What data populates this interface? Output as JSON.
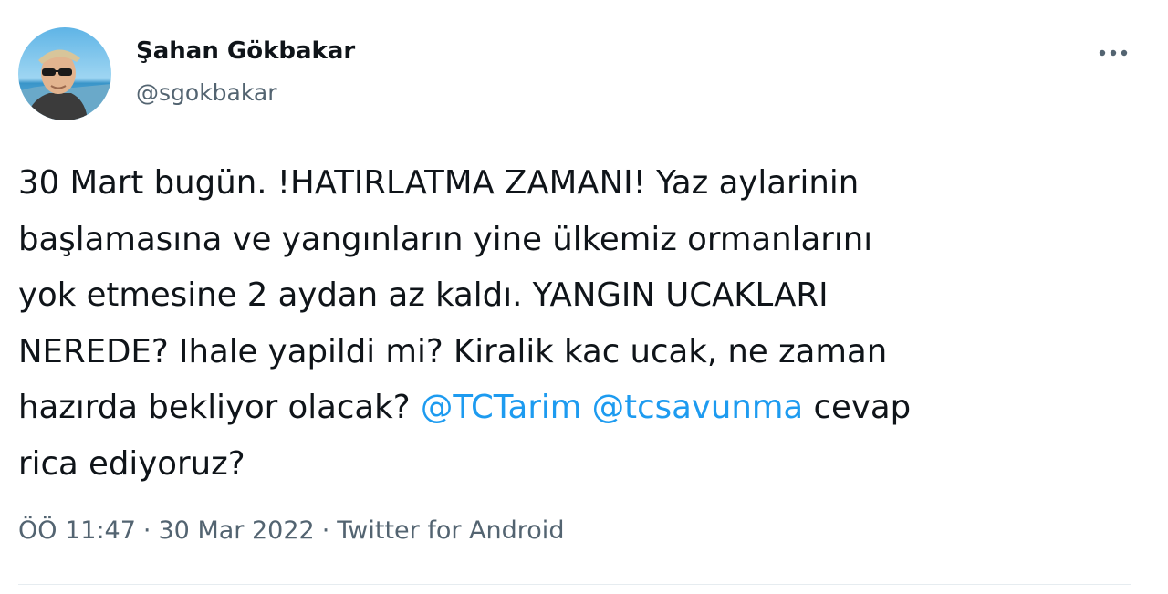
{
  "author": {
    "display_name": "Şahan Gökbakar",
    "handle": "@sgokbakar"
  },
  "more_icon": "more-horizontal-icon",
  "tweet": {
    "lines": [
      [
        "30 Mart bugün. !HATIRLATMA ZAMANI! Yaz aylarinin"
      ],
      [
        "başlamasına ve yangınların yine ülkemiz ormanlarını"
      ],
      [
        "yok etmesine 2 aydan az kaldı. YANGIN UCAKLARI"
      ],
      [
        "NEREDE? Ihale yapildi mi? Kiralik kac ucak, ne zaman"
      ],
      [
        "hazırda bekliyor olacak? ",
        "@TCTarim",
        " ",
        "@tcsavunma",
        " cevap"
      ],
      [
        "rica ediyoruz?"
      ]
    ],
    "mentions": [
      "@TCTarim",
      "@tcsavunma"
    ]
  },
  "meta": {
    "time": "ÖÖ 11:47",
    "separator": "·",
    "date": "30 Mar 2022",
    "source": "Twitter for Android"
  },
  "colors": {
    "text": "#0f1419",
    "secondary": "#536471",
    "mention": "#1d9bf0"
  }
}
